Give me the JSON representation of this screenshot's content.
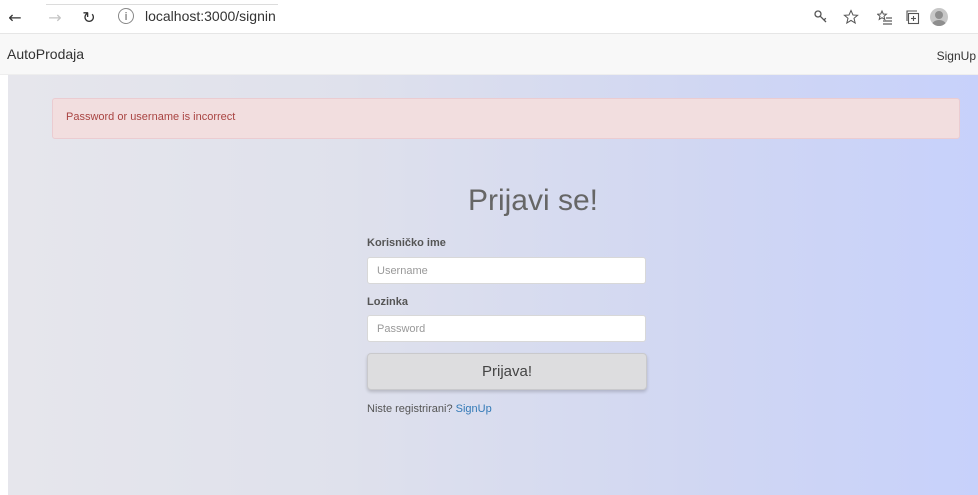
{
  "browser": {
    "back_glyph": "←",
    "forward_glyph": "→",
    "refresh_glyph": "↻",
    "info_glyph": "i",
    "url": "localhost:3000/signin",
    "icons": [
      "key-icon",
      "star-icon",
      "favorites-icon",
      "collections-icon",
      "profile-icon"
    ]
  },
  "navbar": {
    "brand": "AutoProdaja",
    "signup": "SignUp"
  },
  "alert": {
    "message": "Password or username is incorrect",
    "color": "#a94442",
    "background": "#f2dedf"
  },
  "form": {
    "title": "Prijavi se!",
    "username_label": "Korisničko ime",
    "username_placeholder": "Username",
    "password_label": "Lozinka",
    "password_placeholder": "Password",
    "submit_label": "Prijava!",
    "register_prompt": "Niste registrirani?",
    "register_link": "SignUp"
  }
}
